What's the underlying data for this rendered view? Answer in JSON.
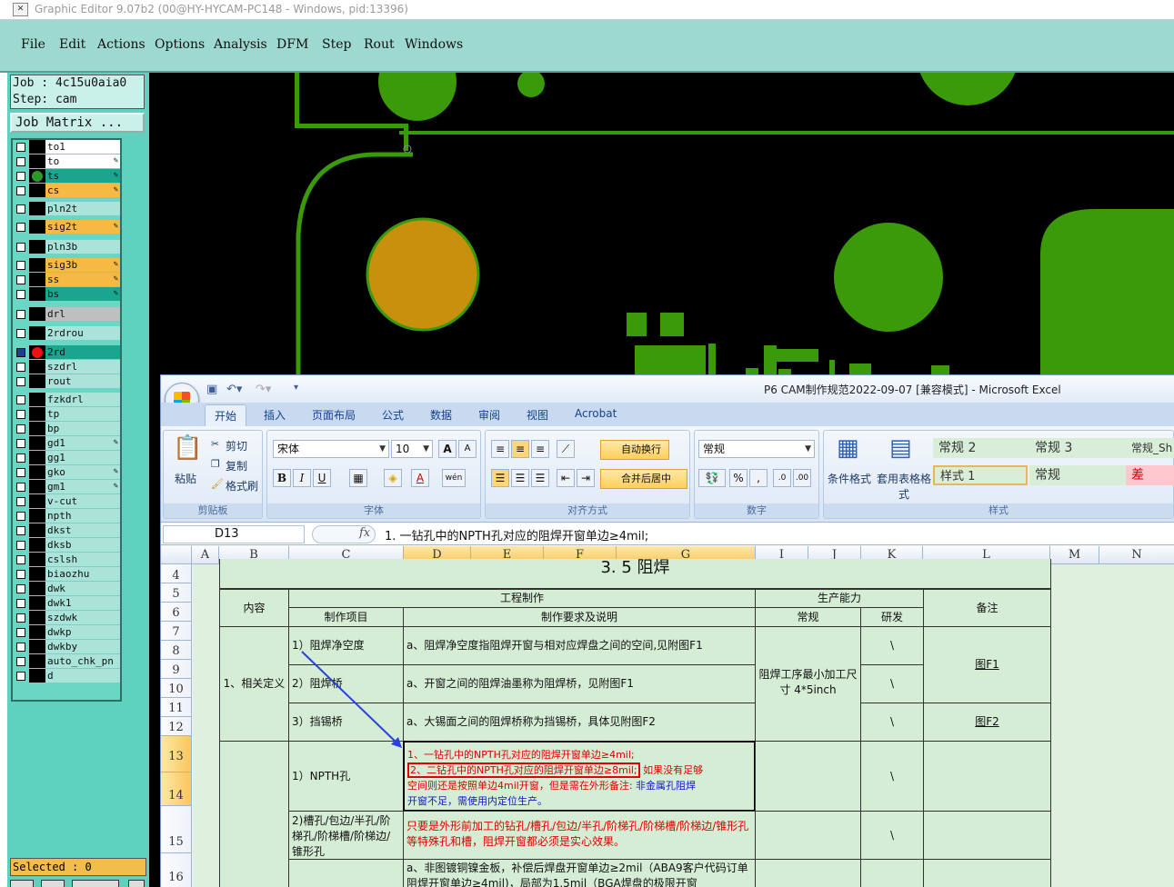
{
  "app": {
    "title": "Graphic Editor 9.07b2 (00@HY-HYCAM-PC148 - Windows, pid:13396)"
  },
  "menu": [
    "File",
    "Edit",
    "Actions",
    "Options",
    "Analysis",
    "DFM",
    "Step",
    "Rout",
    "Windows"
  ],
  "job": {
    "job_label": "Job : 4c15u0aia0",
    "step_label": "Step: cam",
    "matrix_button": "Job Matrix ..."
  },
  "layers": [
    "to1",
    "to",
    "ts",
    "cs",
    "pln2t",
    "sig2t",
    "pln3b",
    "sig3b",
    "ss",
    "bs",
    "drl",
    "2rdrou",
    "2rd",
    "szdrl",
    "rout",
    "fzkdrl",
    "tp",
    "bp",
    "gd1",
    "gg1",
    "gko",
    "gm1",
    "v-cut",
    "npth",
    "dkst",
    "dksb",
    "cslsh",
    "biaozhu",
    "dwk",
    "dwk1",
    "szdwk",
    "dwkp",
    "dwkby",
    "auto_chk_pn",
    "d"
  ],
  "layer_colors": {
    "white": "#ffffff",
    "teal": "#1aa58f",
    "orange": "#f5b944",
    "light": "#a9e3da",
    "gray": "#bfbfbf",
    "green": "#2a9a2a",
    "red": "#ee1111"
  },
  "selected": "Selected : 0",
  "excel": {
    "title": "P6 CAM制作规范2022-09-07  [兼容模式] - Microsoft Excel",
    "tabs": [
      "开始",
      "插入",
      "页面布局",
      "公式",
      "数据",
      "审阅",
      "视图",
      "Acrobat"
    ],
    "clipboard": {
      "paste": "粘贴",
      "cut": "剪切",
      "copy": "复制",
      "format_painter": "格式刷",
      "label": "剪贴板"
    },
    "font": {
      "name": "宋体",
      "size": "10",
      "bold": "B",
      "italic": "I",
      "underline": "U",
      "label": "字体",
      "grow": "A",
      "shrink": "A",
      "color_char": "A",
      "wen": "wén"
    },
    "align": {
      "wrap": "自动换行",
      "merge": "合并后居中",
      "label": "对齐方式"
    },
    "number": {
      "format": "常规",
      "percent": "%",
      "comma": ",",
      "label": "数字"
    },
    "styles": {
      "cond": "条件格式",
      "table": "套用表格格式",
      "label": "样式",
      "cells": [
        "常规 2",
        "常规 3",
        "常规_Sh",
        "样式 1",
        "常规",
        "差"
      ]
    },
    "namebox": "D13",
    "fx": "fx",
    "formula": "1. 一钻孔中的NPTH孔对应的阻焊开窗单边≥4mil;",
    "columns": [
      "A",
      "B",
      "C",
      "D",
      "E",
      "F",
      "G",
      "I",
      "J",
      "K",
      "L",
      "M",
      "N"
    ],
    "rows": [
      "4",
      "5",
      "6",
      "7",
      "8",
      "9",
      "10",
      "11",
      "12",
      "13",
      "14",
      "15",
      "16"
    ],
    "table": {
      "top_partial": "3. 5  阻焊",
      "h_content": "内容",
      "h_eng": "工程制作",
      "h_cap": "生产能力",
      "h_note": "备注",
      "h_item": "制作项目",
      "h_req": "制作要求及说明",
      "h_normal": "常规",
      "h_rd": "研发",
      "sec1": "1、相关定义",
      "item1": "1）阻焊净空度",
      "req1": "a、阻焊净空度指阻焊开窗与相对应焊盘之间的空间,见附图F1",
      "item2": "2）阻焊桥",
      "req2": "a、开窗之间的阻焊油墨称为阻焊桥，见附图F1",
      "item3": "3）挡锡桥",
      "req3": "a、大锡面之间的阻焊桥称为挡锡桥，具体见附图F2",
      "cap_normal": "阻焊工序最小加工尺寸 4*5inch",
      "bs": "\\",
      "note1": "图F1",
      "note2": "图F2",
      "item4": "1）NPTH孔",
      "req4_l1": "1、一钻孔中的NPTH孔对应的阻焊开窗单边≥4mil;",
      "req4_l2a": "2、二钻孔中的NPTH孔对应的阻焊开窗单边≥8mil;",
      "req4_l2b": " 如果没有足够",
      "req4_l3": "空间则还是按照单边4mil开窗，但是需在外形备注:",
      "req4_l3b": " 非金属孔阻焊",
      "req4_l4": "开窗不足，需使用内定位生产。",
      "item5": "2)槽孔/包边/半孔/阶梯孔/阶梯槽/阶梯边/锥形孔",
      "req5": "只要是外形前加工的钻孔/槽孔/包边/半孔/阶梯孔/阶梯槽/阶梯边/锥形孔等特殊孔和槽，阻焊开窗都必须是实心效果。",
      "req6": "a、非图镀铜镍金板，补偿后焊盘开窗单边≥2mil（ABA9客户代码订单阻焊开窗单边≥4mil)，局部为1.5mil（BGA焊盘的极限开窗"
    }
  }
}
